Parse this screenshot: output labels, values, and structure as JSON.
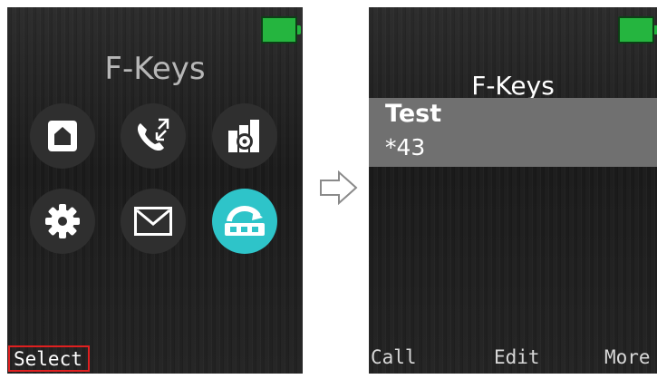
{
  "left_screen": {
    "title": "F-Keys",
    "icons": [
      {
        "name": "home-icon"
      },
      {
        "name": "call-transfer-icon"
      },
      {
        "name": "building-settings-icon"
      },
      {
        "name": "gear-icon"
      },
      {
        "name": "mail-icon"
      },
      {
        "name": "f-keys-icon",
        "selected": true
      }
    ],
    "softkey_left": "Select"
  },
  "right_screen": {
    "title": "F-Keys",
    "items": [
      {
        "name": "Test",
        "number": "*43"
      }
    ],
    "softkeys": {
      "left": "Call",
      "center": "Edit",
      "right": "More"
    }
  },
  "colors": {
    "selected_icon": "#2ec4c9",
    "battery": "#25b53f",
    "highlight_border": "#e02020"
  }
}
